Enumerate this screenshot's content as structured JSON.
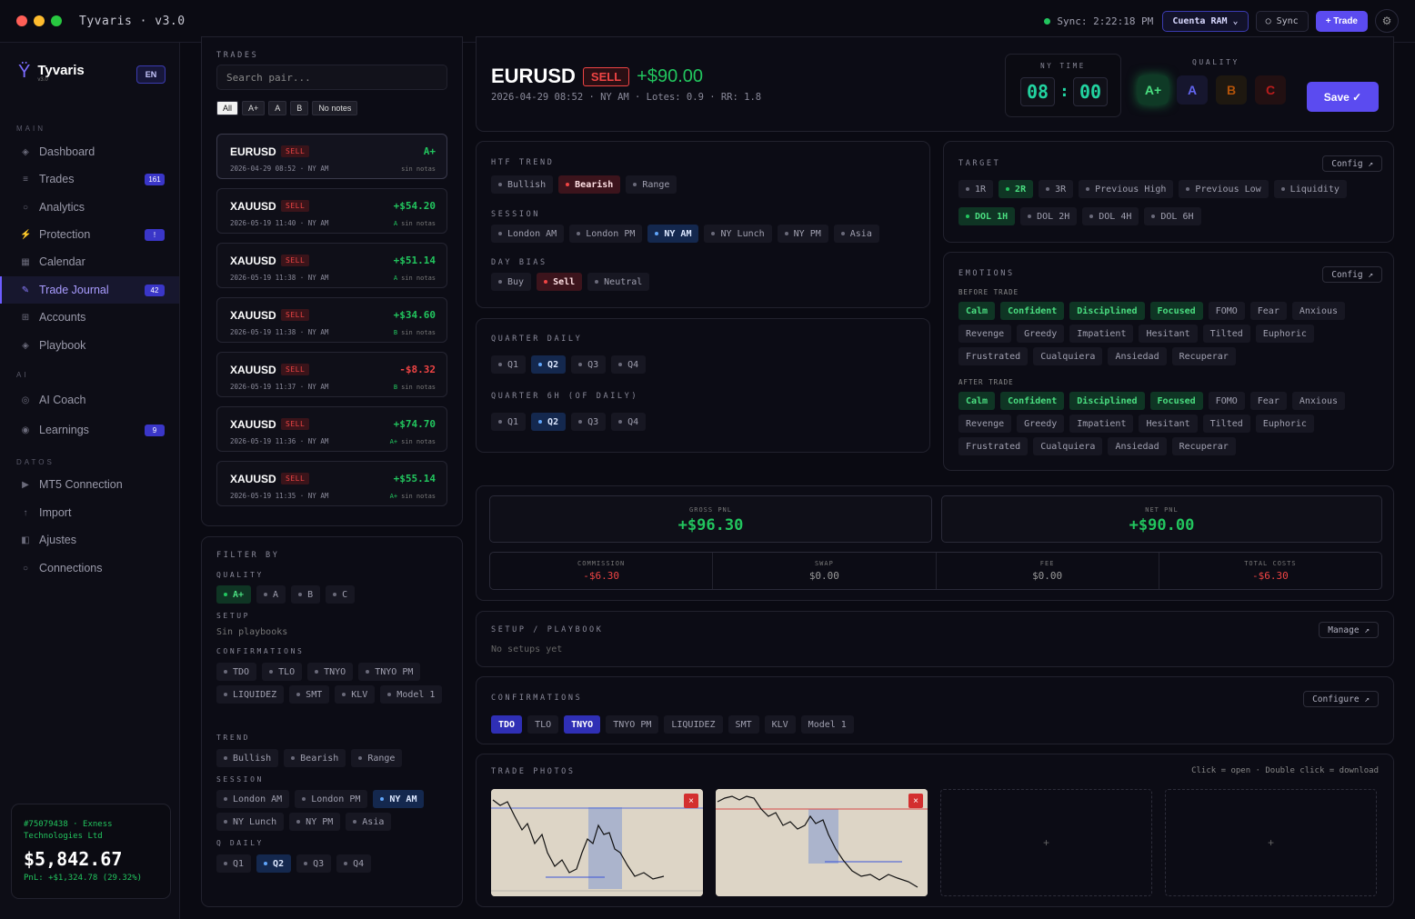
{
  "titlebar": {
    "title": "Tyvaris · v3.0",
    "sync": "Sync: 2:22:18 PM",
    "account": "Cuenta RAM ⌄",
    "sync_btn": "○ Sync",
    "trade_btn": "+ Trade"
  },
  "sidebar": {
    "brand": "Tyvaris",
    "version": "v3.0",
    "lang": "EN",
    "sections": {
      "main": "MAIN",
      "ai": "AI",
      "datos": "DATOS"
    },
    "items": [
      {
        "icon": "◈",
        "label": "Dashboard"
      },
      {
        "icon": "≡",
        "label": "Trades",
        "badge": "161"
      },
      {
        "icon": "○",
        "label": "Analytics"
      },
      {
        "icon": "⚡",
        "label": "Protection",
        "badge": "!"
      },
      {
        "icon": "▦",
        "label": "Calendar"
      },
      {
        "icon": "✎",
        "label": "Trade Journal",
        "badge": "42"
      },
      {
        "icon": "⊞",
        "label": "Accounts"
      },
      {
        "icon": "◈",
        "label": "Playbook"
      },
      {
        "icon": "◎",
        "label": "AI Coach"
      },
      {
        "icon": "◉",
        "label": "Learnings",
        "badge": "9"
      },
      {
        "icon": "▶",
        "label": "MT5 Connection"
      },
      {
        "icon": "↑",
        "label": "Import"
      },
      {
        "icon": "◧",
        "label": "Ajustes"
      },
      {
        "icon": "○",
        "label": "Connections"
      }
    ],
    "account": {
      "name": "#75079438 · Exness Technologies Ltd",
      "balance": "$5,842.67",
      "pnl": "PnL: +$1,324.78 (29.32%)"
    }
  },
  "trades": {
    "title": "TRADES",
    "search_placeholder": "Search pair...",
    "filters": [
      "All",
      "A+",
      "A",
      "B",
      "No notes"
    ],
    "list": [
      {
        "pair": "EURUSD",
        "side": "SELL",
        "date": "2026-04-29 08:52 · NY AM",
        "value": "A+",
        "grade": "",
        "notes": "sin notas"
      },
      {
        "pair": "XAUUSD",
        "side": "SELL",
        "date": "2026-05-19 11:40 · NY AM",
        "value": "+$54.20",
        "grade": "A",
        "notes": "sin notas"
      },
      {
        "pair": "XAUUSD",
        "side": "SELL",
        "date": "2026-05-19 11:38 · NY AM",
        "value": "+$51.14",
        "grade": "A",
        "notes": "sin notas"
      },
      {
        "pair": "XAUUSD",
        "side": "SELL",
        "date": "2026-05-19 11:38 · NY AM",
        "value": "+$34.60",
        "grade": "B",
        "notes": "sin notas"
      },
      {
        "pair": "XAUUSD",
        "side": "SELL",
        "date": "2026-05-19 11:37 · NY AM",
        "value": "-$8.32",
        "grade": "B",
        "notes": "sin notas"
      },
      {
        "pair": "XAUUSD",
        "side": "SELL",
        "date": "2026-05-19 11:36 · NY AM",
        "value": "+$74.70",
        "grade": "A+",
        "notes": "sin notas"
      },
      {
        "pair": "XAUUSD",
        "side": "SELL",
        "date": "2026-05-19 11:35 · NY AM",
        "value": "+$55.14",
        "grade": "A+",
        "notes": "sin notas"
      }
    ]
  },
  "filterby": {
    "title": "FILTER BY",
    "quality_label": "QUALITY",
    "quality": [
      "A+",
      "A",
      "B",
      "C"
    ],
    "setup_label": "SETUP",
    "setup_value": "Sin playbooks",
    "conf_label": "CONFIRMATIONS",
    "confirmations": [
      "TDO",
      "TLO",
      "TNYO",
      "TNYO PM",
      "LIQUIDEZ",
      "SMT",
      "KLV",
      "Model 1"
    ],
    "trend_label": "TREND",
    "trend": [
      "Bullish",
      "Bearish",
      "Range"
    ],
    "session_label": "SESSION",
    "session": [
      "London AM",
      "London PM",
      "NY AM",
      "NY Lunch",
      "NY PM",
      "Asia"
    ],
    "qdaily_label": "Q DAILY",
    "qdaily": [
      "Q1",
      "Q2",
      "Q3",
      "Q4"
    ]
  },
  "header": {
    "pair": "EURUSD",
    "side": "SELL",
    "pnl": "+$90.00",
    "sub": "2026-04-29 08:52 · NY AM · Lotes: 0.9 · RR: 1.8",
    "ny_label": "NY TIME",
    "hh": "08",
    "mm": "00",
    "quality_label": "QUALITY",
    "qualities": [
      "A+",
      "A",
      "B",
      "C"
    ],
    "save": "Save ✓"
  },
  "htf": {
    "trend_label": "HTF TREND",
    "trend": [
      "Bullish",
      "Bearish",
      "Range"
    ],
    "session_label": "SESSION",
    "session": [
      "London AM",
      "London PM",
      "NY AM",
      "NY Lunch",
      "NY PM",
      "Asia"
    ],
    "bias_label": "DAY BIAS",
    "bias": [
      "Buy",
      "Sell",
      "Neutral"
    ]
  },
  "quarter": {
    "daily_label": "QUARTER DAILY",
    "daily": [
      "Q1",
      "Q2",
      "Q3",
      "Q4"
    ],
    "h6_label": "QUARTER 6H (OF DAILY)",
    "h6": [
      "Q1",
      "Q2",
      "Q3",
      "Q4"
    ]
  },
  "target": {
    "label": "TARGET",
    "config": "Config ↗",
    "items": [
      "1R",
      "2R",
      "3R",
      "Previous High",
      "Previous Low",
      "Liquidity",
      "DOL 1H",
      "DOL 2H",
      "DOL 4H",
      "DOL 6H"
    ]
  },
  "emotions": {
    "label": "EMOTIONS",
    "config": "Config ↗",
    "before_label": "BEFORE TRADE",
    "after_label": "AFTER TRADE",
    "items": [
      "Calm",
      "Confident",
      "Disciplined",
      "Focused",
      "FOMO",
      "Fear",
      "Anxious",
      "Revenge",
      "Greedy",
      "Impatient",
      "Hesitant",
      "Tilted",
      "Euphoric",
      "Frustrated",
      "Cualquiera",
      "Ansiedad",
      "Recuperar"
    ]
  },
  "pnl": {
    "gross_label": "GROSS PNL",
    "gross": "+$96.30",
    "net_label": "NET PNL",
    "net": "+$90.00",
    "commission_label": "COMMISSION",
    "commission": "-$6.30",
    "swap_label": "SWAP",
    "swap": "$0.00",
    "fee_label": "FEE",
    "fee": "$0.00",
    "total_label": "TOTAL COSTS",
    "total": "-$6.30"
  },
  "setup": {
    "label": "SETUP / PLAYBOOK",
    "empty": "No setups yet",
    "manage": "Manage ↗"
  },
  "confirm": {
    "label": "CONFIRMATIONS",
    "configure": "Configure ↗",
    "items": [
      "TDO",
      "TLO",
      "TNYO",
      "TNYO PM",
      "LIQUIDEZ",
      "SMT",
      "KLV",
      "Model 1"
    ]
  },
  "photos": {
    "label": "TRADE PHOTOS",
    "hint": "Click = open · Double click = download",
    "add": "+"
  },
  "colors": {
    "accent": "#5b4bf0",
    "green": "#22c55e",
    "red": "#ef4444",
    "blue": "#60a5fa"
  }
}
